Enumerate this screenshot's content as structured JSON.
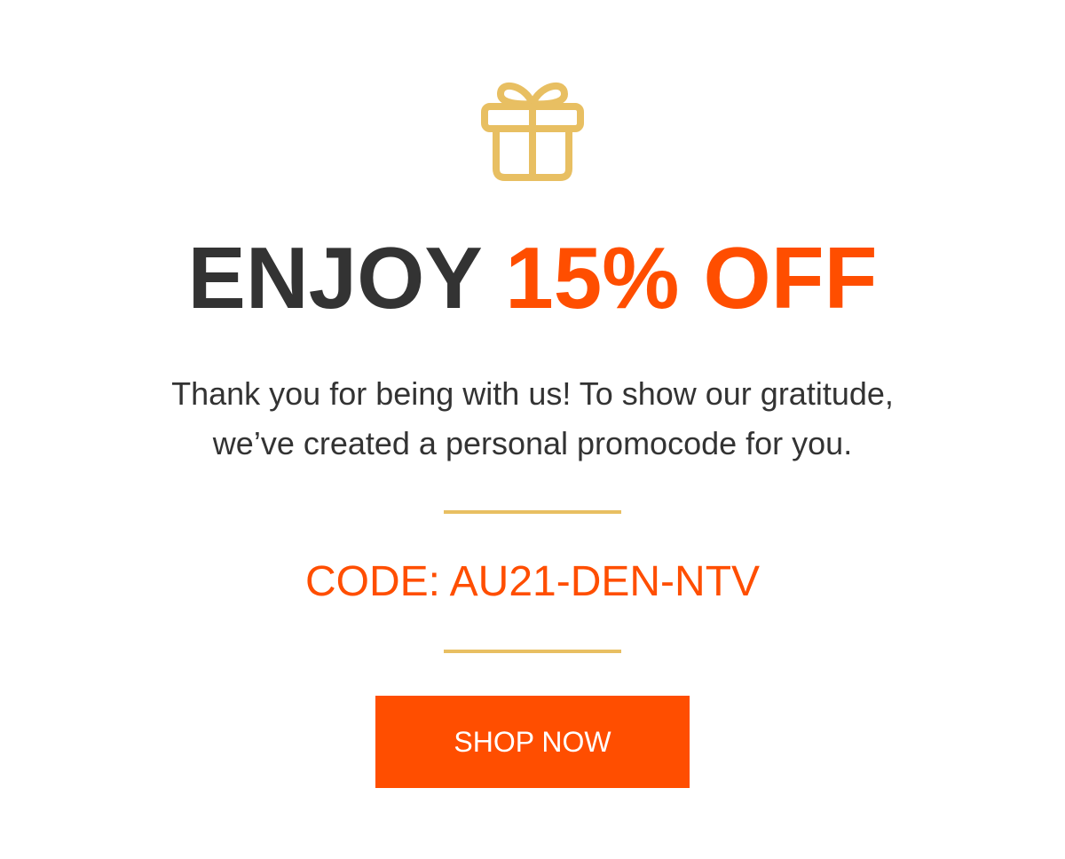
{
  "colors": {
    "accent": "#ff4e00",
    "gold": "#e8bf62",
    "text": "#333333",
    "button_text": "#ffffff"
  },
  "icon": "gift-icon",
  "headline": {
    "lead": "ENJOY ",
    "highlight": "15% OFF"
  },
  "message": {
    "line1": "Thank you for being with us! To show our gratitude,",
    "line2": "we’ve created a personal promocode for you."
  },
  "promo": {
    "code_text": "CODE: AU21-DEN-NTV"
  },
  "cta": {
    "label": "SHOP NOW"
  }
}
